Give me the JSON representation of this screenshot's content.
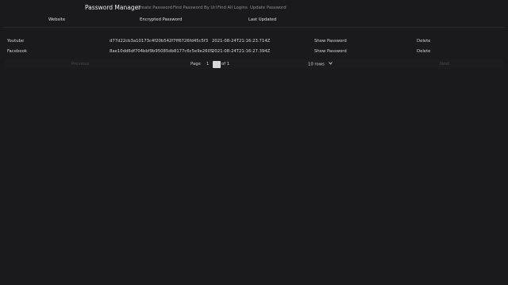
{
  "navbar": {
    "brand": "Password Manager",
    "links": [
      "Create Password",
      "Find Password By Url",
      "Find All Logins",
      "Update Password"
    ]
  },
  "table": {
    "columns": [
      "Website",
      "Encrypted Password",
      "Last Updated"
    ],
    "rows": [
      {
        "website": "Youtube",
        "encrypted": "d77d22cb3a10173c4f20b542f7ff6726fd45c5f3",
        "updated": "2021-08-24T21:16:23.714Z",
        "show": "Show Password",
        "delete": "Delete"
      },
      {
        "website": "Facebook",
        "encrypted": "8ae10dd6df704bbf9b95085db8177c6c5e9e2605",
        "updated": "2021-08-24T21:16:27.394Z",
        "show": "Show Password",
        "delete": "Delete"
      }
    ]
  },
  "pagination": {
    "previous": "Previous",
    "page_label": "Page",
    "page_number": "1",
    "of_label": "of 1",
    "rows_option": "10 rows",
    "next": "Next"
  },
  "icons": {
    "rows_select": "chevron-down-icon"
  }
}
